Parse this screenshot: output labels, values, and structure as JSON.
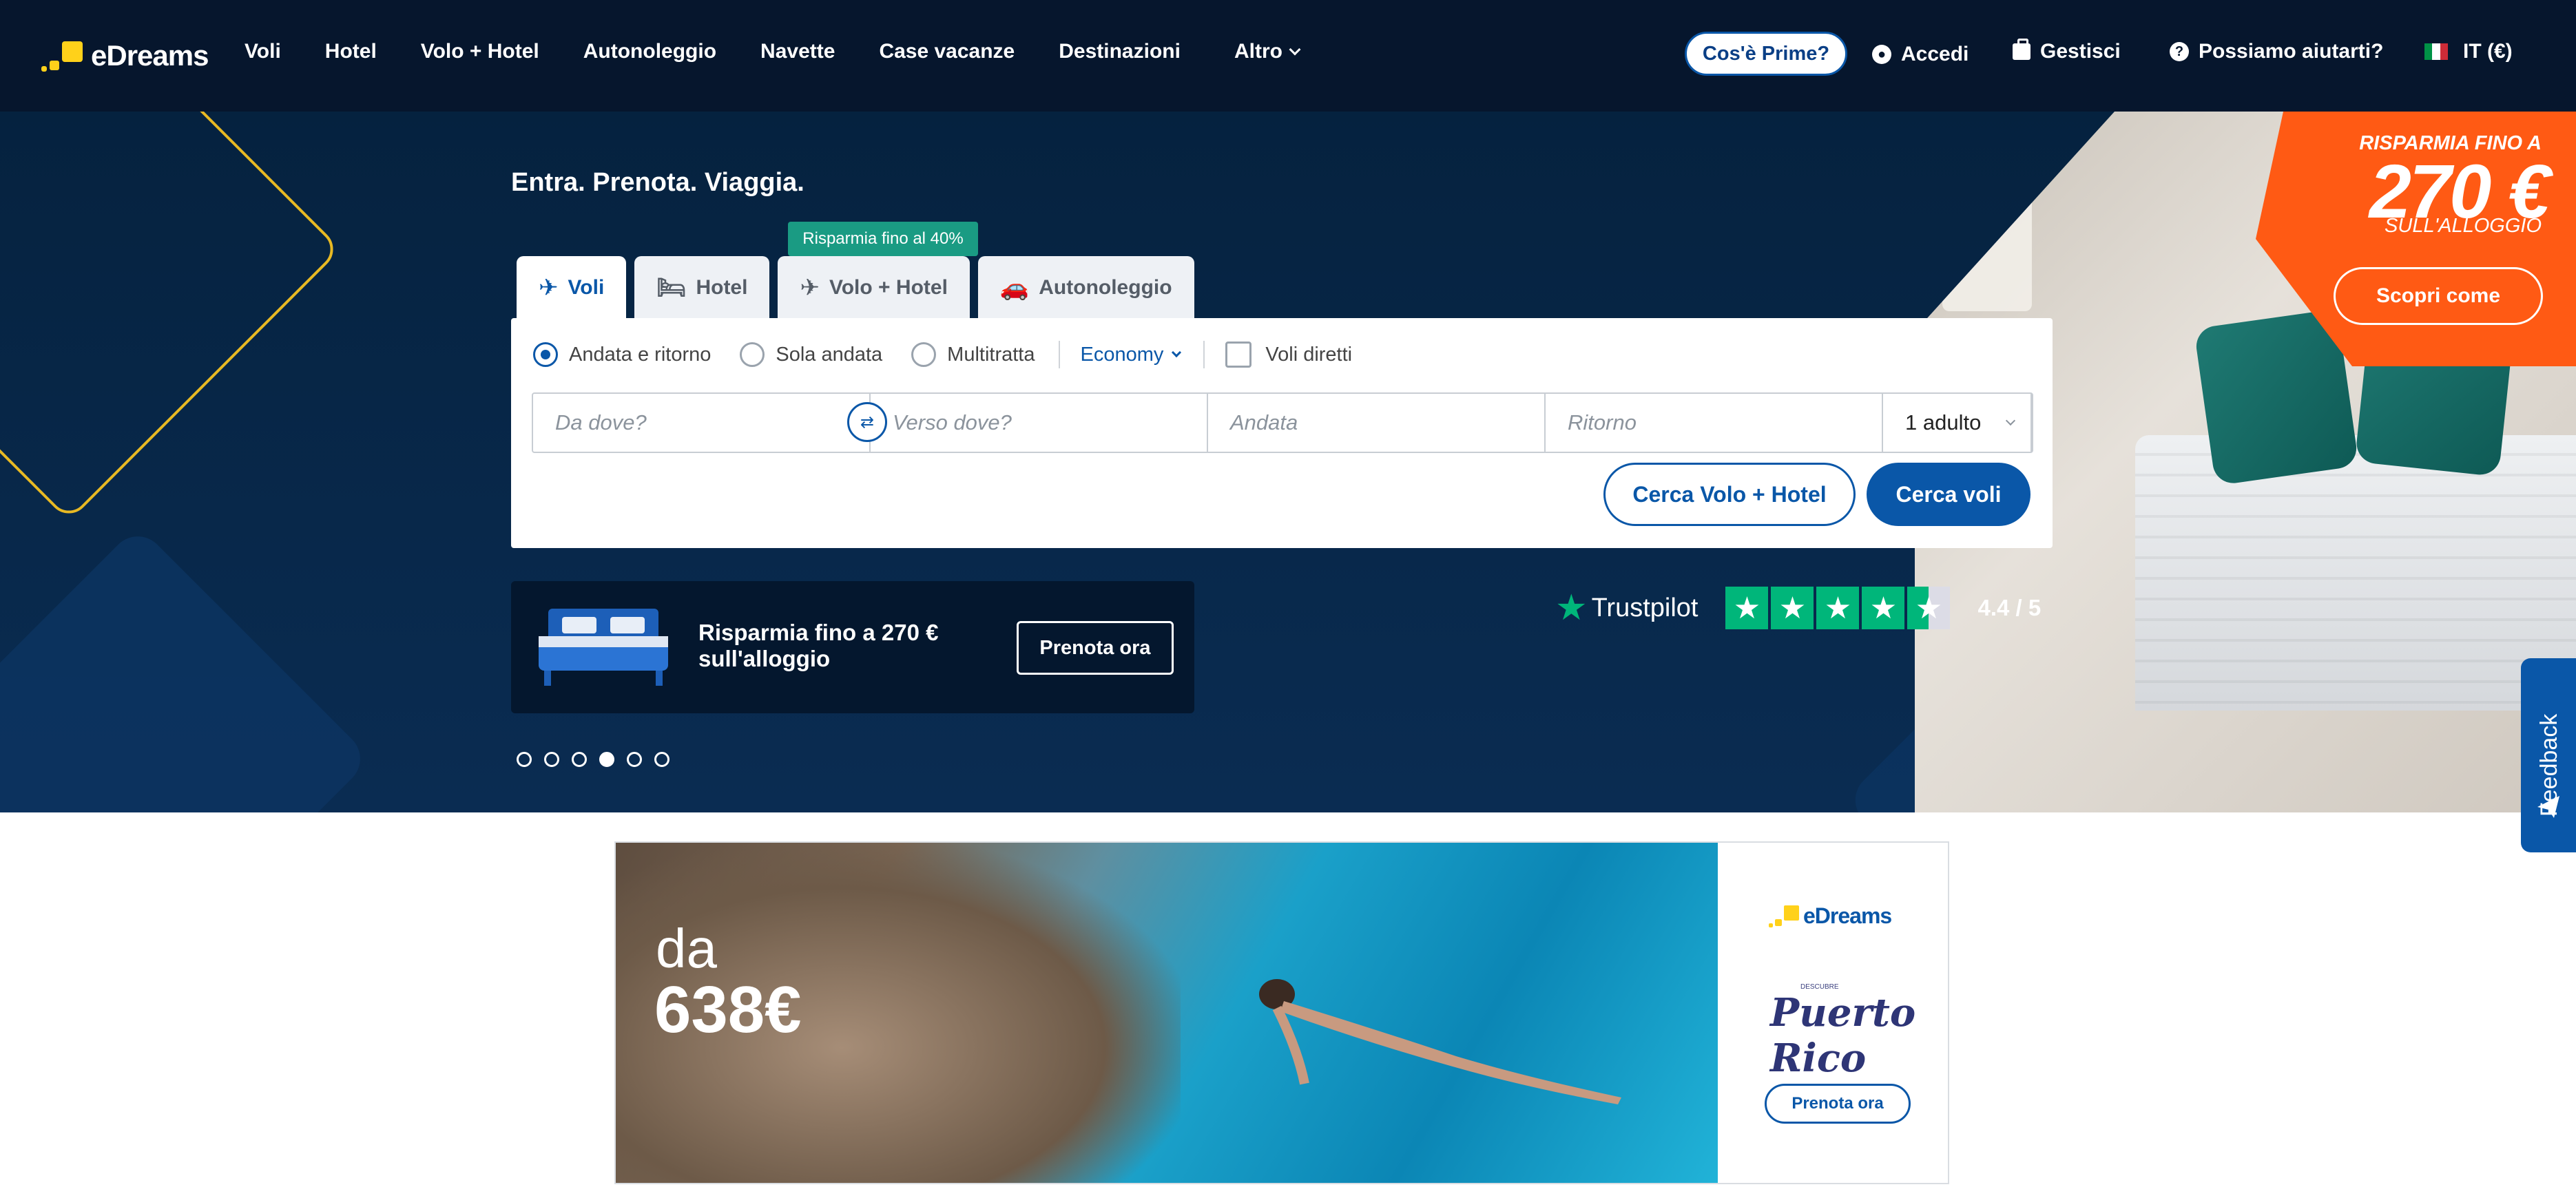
{
  "header": {
    "logo_text": "eDreams",
    "nav": [
      {
        "label": "Voli"
      },
      {
        "label": "Hotel"
      },
      {
        "label": "Volo + Hotel"
      },
      {
        "label": "Autonoleggio"
      },
      {
        "label": "Navette"
      },
      {
        "label": "Case vacanze"
      },
      {
        "label": "Destinazioni"
      },
      {
        "label": "Altro"
      }
    ],
    "prime_button": "Cos'è Prime?",
    "login": "Accedi",
    "manage": "Gestisci",
    "help": "Possiamo aiutarti?",
    "locale": "IT (€)"
  },
  "hero": {
    "tagline": "Entra. Prenota. Viaggia.",
    "tab_badge": "Risparmia fino al 40%",
    "tabs": [
      {
        "label": "Voli",
        "icon": "plane-icon"
      },
      {
        "label": "Hotel",
        "icon": "bed-icon"
      },
      {
        "label": "Volo + Hotel",
        "icon": "plane-bed-icon"
      },
      {
        "label": "Autonoleggio",
        "icon": "car-icon"
      }
    ],
    "trip_options": [
      {
        "label": "Andata e ritorno",
        "selected": true
      },
      {
        "label": "Sola andata",
        "selected": false
      },
      {
        "label": "Multitratta",
        "selected": false
      }
    ],
    "cabin_class": "Economy",
    "direct_flights": "Voli diretti",
    "fields": {
      "from_placeholder": "Da dove?",
      "to_placeholder": "Verso dove?",
      "depart_placeholder": "Andata",
      "return_placeholder": "Ritorno",
      "passengers": "1 adulto"
    },
    "search_hotel_button": "Cerca Volo + Hotel",
    "search_button": "Cerca voli",
    "promo": {
      "line1": "Risparmia fino a 270 €",
      "line2": "sull'alloggio",
      "button": "Prenota ora"
    },
    "orange_promo": {
      "top": "RISPARMIA FINO A",
      "amount": "270 €",
      "bottom": "SULL'ALLOGGIO",
      "button": "Scopri come"
    },
    "trustpilot": {
      "brand": "Trustpilot",
      "rating": "4.4 / 5"
    },
    "carousel": {
      "count": 6,
      "active": 4
    },
    "feedback": "Feedback"
  },
  "banner": {
    "from": "da",
    "price": "638€",
    "brand": "eDreams",
    "partner_small": "DESCUBRE",
    "partner": "Puerto Rico",
    "button": "Prenota ora"
  },
  "colors": {
    "header_bg": "#06162d",
    "hero_bg": "#05223f",
    "primary": "#0a57a8",
    "accent_orange": "#ff5a14",
    "logo_yellow": "#ffd11a",
    "trustpilot_green": "#00b67a",
    "badge_green": "#1a9b83"
  }
}
